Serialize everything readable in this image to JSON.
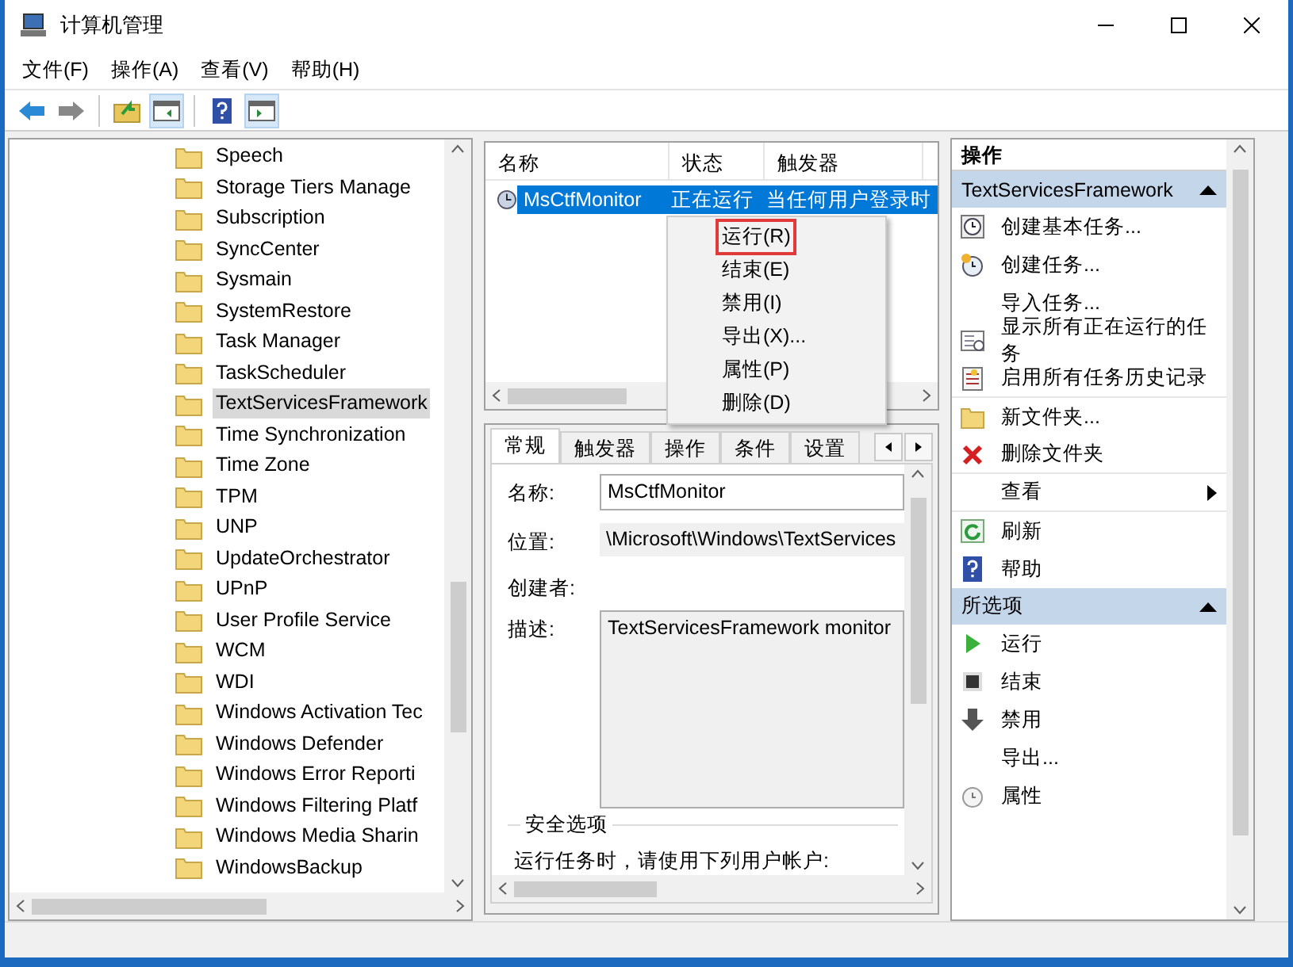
{
  "window": {
    "title": "计算机管理"
  },
  "menu": [
    "文件(F)",
    "操作(A)",
    "查看(V)",
    "帮助(H)"
  ],
  "tree": {
    "items": [
      {
        "label": "Speech",
        "selected": false
      },
      {
        "label": "Storage Tiers Manage",
        "selected": false
      },
      {
        "label": "Subscription",
        "selected": false
      },
      {
        "label": "SyncCenter",
        "selected": false
      },
      {
        "label": "Sysmain",
        "selected": false
      },
      {
        "label": "SystemRestore",
        "selected": false
      },
      {
        "label": "Task Manager",
        "selected": false
      },
      {
        "label": "TaskScheduler",
        "selected": false
      },
      {
        "label": "TextServicesFramework",
        "selected": true
      },
      {
        "label": "Time Synchronization",
        "selected": false
      },
      {
        "label": "Time Zone",
        "selected": false
      },
      {
        "label": "TPM",
        "selected": false
      },
      {
        "label": "UNP",
        "selected": false
      },
      {
        "label": "UpdateOrchestrator",
        "selected": false
      },
      {
        "label": "UPnP",
        "selected": false
      },
      {
        "label": "User Profile Service",
        "selected": false
      },
      {
        "label": "WCM",
        "selected": false
      },
      {
        "label": "WDI",
        "selected": false
      },
      {
        "label": "Windows Activation Tec",
        "selected": false
      },
      {
        "label": "Windows Defender",
        "selected": false
      },
      {
        "label": "Windows Error Reporti",
        "selected": false
      },
      {
        "label": "Windows Filtering Platf",
        "selected": false
      },
      {
        "label": "Windows Media Sharin",
        "selected": false
      },
      {
        "label": "WindowsBackup",
        "selected": false
      }
    ]
  },
  "task_list": {
    "columns": [
      "名称",
      "状态",
      "触发器"
    ],
    "rows": [
      {
        "cells": [
          "MsCtfMonitor",
          "正在运行",
          "当任何用户登录时"
        ],
        "selected": true
      }
    ]
  },
  "context_menu": {
    "items": [
      {
        "label": "运行(R)",
        "marked": true
      },
      {
        "label": "结束(E)",
        "marked": false
      },
      {
        "label": "禁用(I)",
        "marked": false
      },
      {
        "label": "导出(X)...",
        "marked": false
      },
      {
        "label": "属性(P)",
        "marked": false
      },
      {
        "label": "删除(D)",
        "marked": false
      }
    ]
  },
  "details": {
    "tabs": [
      {
        "label": "常规",
        "selected": true
      },
      {
        "label": "触发器",
        "selected": false
      },
      {
        "label": "操作",
        "selected": false
      },
      {
        "label": "条件",
        "selected": false
      },
      {
        "label": "设置",
        "selected": false
      }
    ],
    "fields": [
      {
        "kind": "input",
        "label": "名称:",
        "value": "MsCtfMonitor"
      },
      {
        "kind": "text",
        "label": "位置:",
        "value": "\\Microsoft\\Windows\\TextServices"
      },
      {
        "kind": "text",
        "label": "创建者:"
      },
      {
        "kind": "textarea",
        "label": "描述:",
        "value": "TextServicesFramework monitor"
      }
    ],
    "security": {
      "title": "安全选项",
      "text": "运行任务时，请使用下列用户帐户:"
    }
  },
  "actions": {
    "header": "操作",
    "sections": [
      {
        "title": "TextServicesFramework",
        "items": [
          {
            "kind": "basic",
            "label": "创建基本任务...",
            "separator_after": false
          },
          {
            "kind": "create",
            "label": "创建任务...",
            "separator_after": false
          },
          {
            "kind": "plain",
            "label": "导入任务...",
            "separator_after": false
          },
          {
            "kind": "running",
            "label": "显示所有正在运行的任务",
            "separator_after": false
          },
          {
            "kind": "history",
            "label": "启用所有任务历史记录",
            "separator_after": true
          },
          {
            "kind": "folder",
            "label": "新文件夹...",
            "separator_after": false
          },
          {
            "kind": "delete",
            "label": "删除文件夹",
            "separator_after": true
          },
          {
            "kind": "submenu",
            "label": "查看",
            "separator_after": true
          },
          {
            "kind": "refresh",
            "label": "刷新",
            "separator_after": false
          },
          {
            "kind": "help",
            "label": "帮助",
            "separator_after": false
          }
        ]
      },
      {
        "title": "所选项",
        "items": [
          {
            "kind": "run",
            "label": "运行",
            "separator_after": false
          },
          {
            "kind": "stop",
            "label": "结束",
            "separator_after": false
          },
          {
            "kind": "disable",
            "label": "禁用",
            "separator_after": false
          },
          {
            "kind": "plain",
            "label": "导出...",
            "separator_after": false
          },
          {
            "kind": "props",
            "label": "属性",
            "separator_after": false
          }
        ]
      }
    ]
  }
}
